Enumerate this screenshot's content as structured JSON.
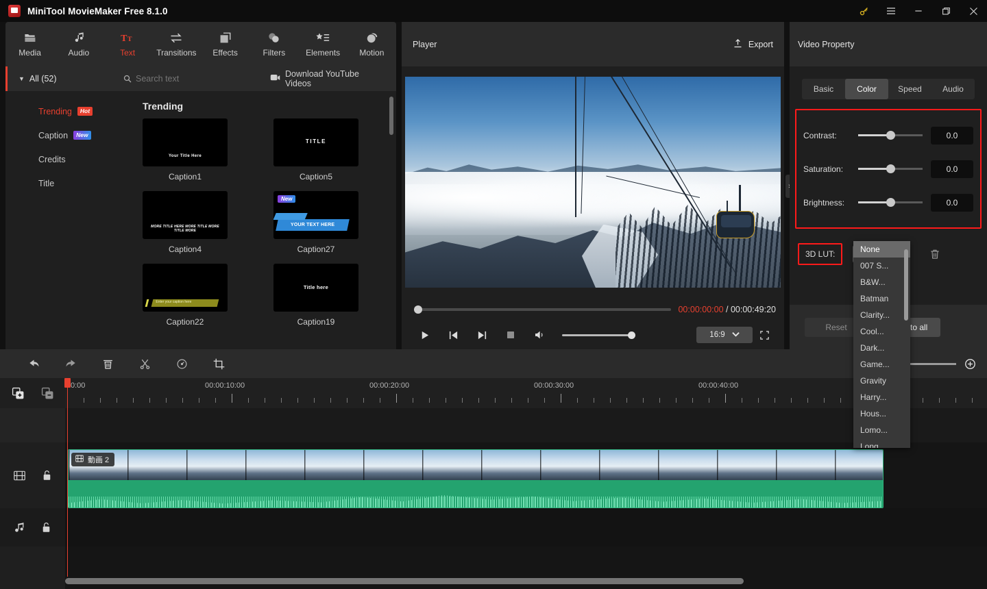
{
  "window": {
    "title": "MiniTool MovieMaker Free 8.1.0",
    "controls": {
      "key": "key-icon",
      "menu": "hamburger-icon",
      "minimize": "minimize-icon",
      "maximize": "maximize-icon",
      "close": "close-icon"
    }
  },
  "toolbar_tabs": [
    {
      "label": "Media",
      "icon": "folder-icon",
      "active": false
    },
    {
      "label": "Audio",
      "icon": "music-note-icon",
      "active": false
    },
    {
      "label": "Text",
      "icon": "text-tt-icon",
      "active": true
    },
    {
      "label": "Transitions",
      "icon": "transitions-arrows-icon",
      "active": false
    },
    {
      "label": "Effects",
      "icon": "effects-squares-icon",
      "active": false
    },
    {
      "label": "Filters",
      "icon": "filters-circles-icon",
      "active": false
    },
    {
      "label": "Elements",
      "icon": "elements-star-list-icon",
      "active": false
    },
    {
      "label": "Motion",
      "icon": "motion-sphere-icon",
      "active": false
    }
  ],
  "library": {
    "all_label": "All (52)",
    "categories": [
      {
        "label": "Trending",
        "badge": "Hot",
        "badge_type": "hot",
        "active": true
      },
      {
        "label": "Caption",
        "badge": "New",
        "badge_type": "new",
        "active": false
      },
      {
        "label": "Credits",
        "badge": "",
        "badge_type": "",
        "active": false
      },
      {
        "label": "Title",
        "badge": "",
        "badge_type": "",
        "active": false
      }
    ],
    "search_placeholder": "Search text",
    "download_label": "Download YouTube Videos",
    "section_title": "Trending",
    "templates": [
      {
        "label": "Caption1",
        "preview_text": "Your  Title Here",
        "style": "c1",
        "new": false
      },
      {
        "label": "Caption5",
        "preview_text": "TITLE",
        "style": "c5",
        "new": false
      },
      {
        "label": "Caption4",
        "preview_text": "MORE TITLE HERE MORE TITLE MORE TITLE MORE",
        "style": "c4",
        "new": false
      },
      {
        "label": "Caption27",
        "preview_text": "YOUR TEXT HERE",
        "style": "c27",
        "new": true,
        "new_badge": "New"
      },
      {
        "label": "Caption22",
        "preview_text": "Enter your caption here",
        "style": "c22",
        "new": false
      },
      {
        "label": "Caption19",
        "preview_text": "Title here",
        "style": "c19",
        "new": false
      }
    ]
  },
  "player": {
    "title": "Player",
    "export_label": "Export",
    "current_time": "00:00:00:00",
    "separator": " / ",
    "total_time": "00:00:49:20",
    "aspect_ratio": "16:9",
    "controls": [
      "play-icon",
      "previous-frame-icon",
      "next-frame-icon",
      "stop-icon",
      "volume-icon"
    ],
    "seek_percent": 0,
    "volume_percent": 100
  },
  "property": {
    "title": "Video Property",
    "tabs": [
      {
        "label": "Basic",
        "active": false
      },
      {
        "label": "Color",
        "active": true
      },
      {
        "label": "Speed",
        "active": false
      },
      {
        "label": "Audio",
        "active": false
      }
    ],
    "sliders": [
      {
        "label": "Contrast:",
        "value": "0.0"
      },
      {
        "label": "Saturation:",
        "value": "0.0"
      },
      {
        "label": "Brightness:",
        "value": "0.0"
      }
    ],
    "lut_label": "3D LUT:",
    "lut_value": "None",
    "delete_icon": "trash-icon",
    "reset_label": "Reset",
    "apply_all_label": "Apply to all",
    "highlight_color": "#ff1a1a"
  },
  "lut_dropdown": {
    "open": true,
    "selected": "None",
    "items": [
      "None",
      "007 S...",
      "B&W...",
      "Batman",
      "Clarity...",
      "Cool...",
      "Dark...",
      "Game...",
      "Gravity",
      "Harry...",
      "Hous...",
      "Lomo...",
      "Long..."
    ]
  },
  "timeline": {
    "tools": [
      {
        "icon": "undo-icon",
        "name": "undo"
      },
      {
        "icon": "redo-icon",
        "name": "redo"
      },
      {
        "icon": "delete-icon",
        "name": "delete"
      },
      {
        "icon": "split-scissors-icon",
        "name": "split"
      },
      {
        "icon": "speed-gauge-icon",
        "name": "speed"
      },
      {
        "icon": "crop-icon",
        "name": "crop"
      }
    ],
    "marker_icon": "marker-icon",
    "zoom_percent": 0,
    "zoom_in_icon": "plus-icon",
    "track_sidebar": [
      {
        "icons": [
          "add-track-icon",
          "remove-track-icon"
        ]
      },
      {
        "icons": []
      },
      {
        "icons": [
          "video-track-icon",
          "unlock-icon"
        ]
      },
      {
        "icons": [
          "audio-track-icon",
          "unlock-icon"
        ]
      }
    ],
    "ruler_labels": [
      "0:00",
      "00:00:10:00",
      "00:00:20:00",
      "00:00:30:00",
      "00:00:40:00"
    ],
    "playhead_time": "0:00",
    "clip": {
      "label": "動画 2",
      "icon": "video-clip-icon"
    }
  }
}
